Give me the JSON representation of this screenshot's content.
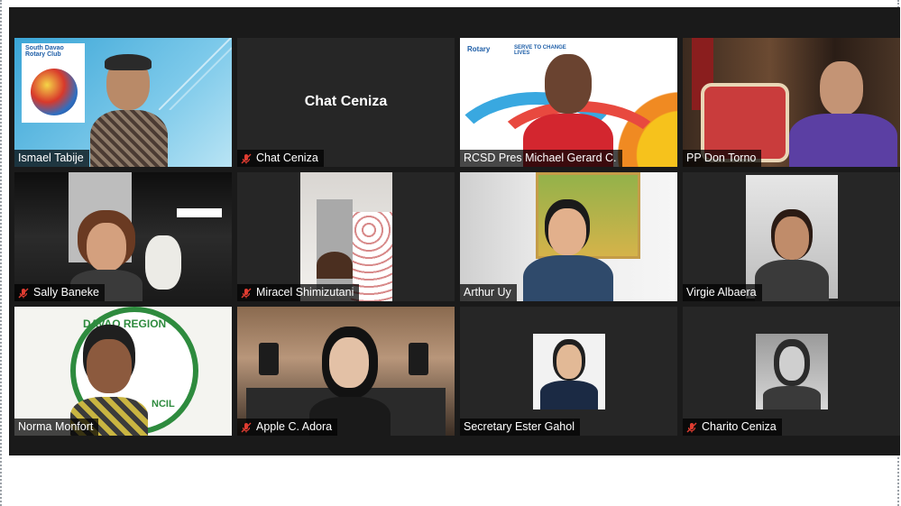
{
  "participants": [
    {
      "name": "Ismael Tabije",
      "muted": false
    },
    {
      "name": "Chat Ceniza",
      "muted": true,
      "display_name": "Chat Ceniza"
    },
    {
      "name": "RCSD Pres Michael Gerard C.",
      "muted": false
    },
    {
      "name": "PP Don Torno",
      "muted": false
    },
    {
      "name": "Sally Baneke",
      "muted": true
    },
    {
      "name": "Miracel Shimizutani",
      "muted": true
    },
    {
      "name": "Arthur Uy",
      "muted": false
    },
    {
      "name": "Virgie Albaera",
      "muted": false,
      "active_speaker": true
    },
    {
      "name": "Norma Monfort",
      "muted": false
    },
    {
      "name": "Apple C.  Adora",
      "muted": true
    },
    {
      "name": "Secretary Ester Gahol",
      "muted": false
    },
    {
      "name": "Charito Ceniza",
      "muted": true
    }
  ],
  "backgrounds": {
    "rotary_logo_text": "South Davao Rotary Club",
    "rotary_banner_text": "Rotary",
    "serve_text": "SERVE TO CHANGE LIVES",
    "davao_region_text": "DAVAO REGION",
    "council_text": "NCIL"
  },
  "colors": {
    "app_bg": "#1a1a1a",
    "tile_bg": "#262626",
    "active_border": "#e8e05a",
    "muted_icon": "#e03c31"
  }
}
